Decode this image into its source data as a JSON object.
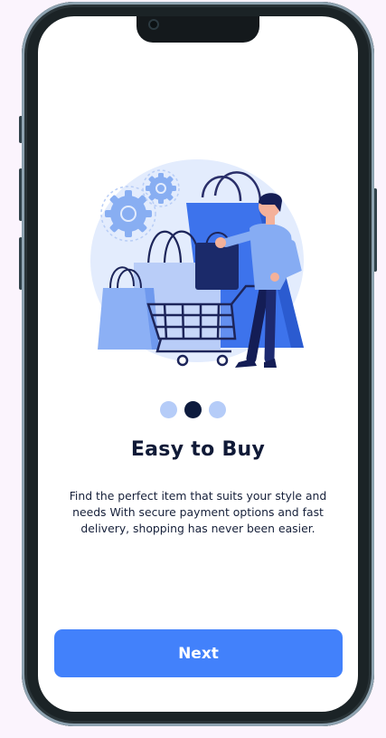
{
  "onboarding": {
    "title": "Easy to Buy",
    "description": "Find the perfect item that suits your style and needs With secure payment options and fast delivery, shopping has never been easier.",
    "next_label": "Next",
    "pagination": {
      "total": 3,
      "active_index": 1
    },
    "illustration": "shopping-cart-person-with-bags"
  },
  "colors": {
    "background": "#fbf4fd",
    "primary": "#4281fb",
    "dot_active": "#0d1b3e",
    "dot_inactive": "#b5ccf8",
    "title_text": "#101a37"
  }
}
